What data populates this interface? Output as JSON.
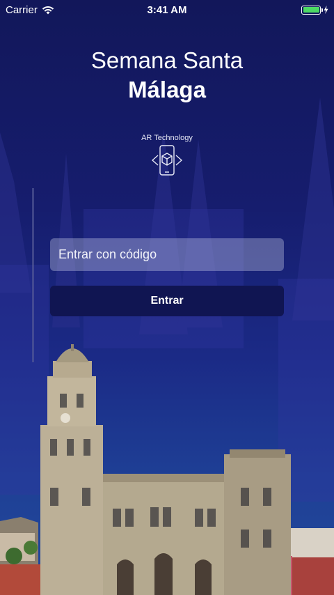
{
  "status_bar": {
    "carrier": "Carrier",
    "time": "3:41 AM",
    "battery_level": 1.0,
    "battery_color": "#4cd964"
  },
  "app": {
    "title_line1": "Semana Santa",
    "title_line2": "Málaga",
    "brand": "AR Technology"
  },
  "form": {
    "code_placeholder": "Entrar con código",
    "code_value": "",
    "submit_label": "Entrar"
  },
  "colors": {
    "background_top": "#12175a",
    "background_bottom": "#234a9c",
    "button": "#101552"
  },
  "icons": {
    "wifi": "wifi-icon",
    "charging": "bolt-icon",
    "brand_logo": "ar-phone-cube-icon"
  }
}
